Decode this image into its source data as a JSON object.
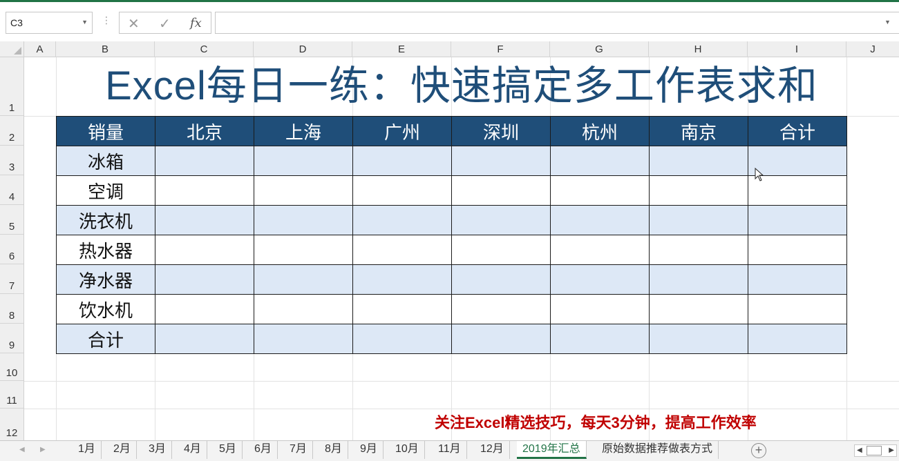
{
  "formula_bar": {
    "name_box": "C3",
    "cancel_glyph": "✕",
    "enter_glyph": "✓",
    "fx_glyph": "fx",
    "formula_value": ""
  },
  "columns": [
    "A",
    "B",
    "C",
    "D",
    "E",
    "F",
    "G",
    "H",
    "I",
    "J"
  ],
  "rows": [
    "1",
    "2",
    "3",
    "4",
    "5",
    "6",
    "7",
    "8",
    "9",
    "10",
    "11",
    "12"
  ],
  "title": "Excel每日一练：快速搞定多工作表求和",
  "table": {
    "header": [
      "销量",
      "北京",
      "上海",
      "广州",
      "深圳",
      "杭州",
      "南京",
      "合计"
    ],
    "row_labels": [
      "冰箱",
      "空调",
      "洗衣机",
      "热水器",
      "净水器",
      "饮水机",
      "合计"
    ]
  },
  "footer_note": "关注Excel精选技巧，每天3分钟，提高工作效率",
  "sheet_tabs": [
    "1月",
    "2月",
    "3月",
    "4月",
    "5月",
    "6月",
    "7月",
    "8月",
    "9月",
    "10月",
    "11月",
    "12月",
    "2019年汇总",
    "原始数据推荐做表方式"
  ],
  "active_tab": "2019年汇总",
  "colors": {
    "header_fill": "#1f4e79",
    "band_fill": "#dde8f6",
    "title_color": "#1f4e79",
    "note_color": "#c00000",
    "accent": "#217346"
  }
}
